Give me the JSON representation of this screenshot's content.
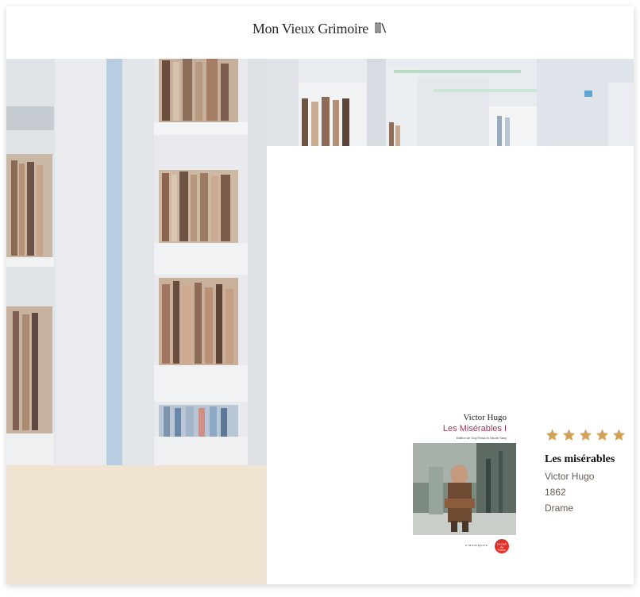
{
  "header": {
    "brand": "Mon Vieux Grimoire",
    "brand_icon": "books-icon"
  },
  "book": {
    "cover": {
      "author": "Victor Hugo",
      "title": "Les Misérables I",
      "edition": "Edition de Guy Rosa et Nicole Savy",
      "collection": "classiques",
      "publisher_badge": "Le Livre de Poche"
    },
    "rating": 5,
    "rating_max": 5,
    "title": "Les misérables",
    "author": "Victor Hugo",
    "year": "1862",
    "genre": "Drame"
  },
  "colors": {
    "star": "#d2a15a",
    "beige_panel": "#f0e3d1",
    "brand_text": "#2a2a2a",
    "cover_title": "#9a3a5e"
  }
}
